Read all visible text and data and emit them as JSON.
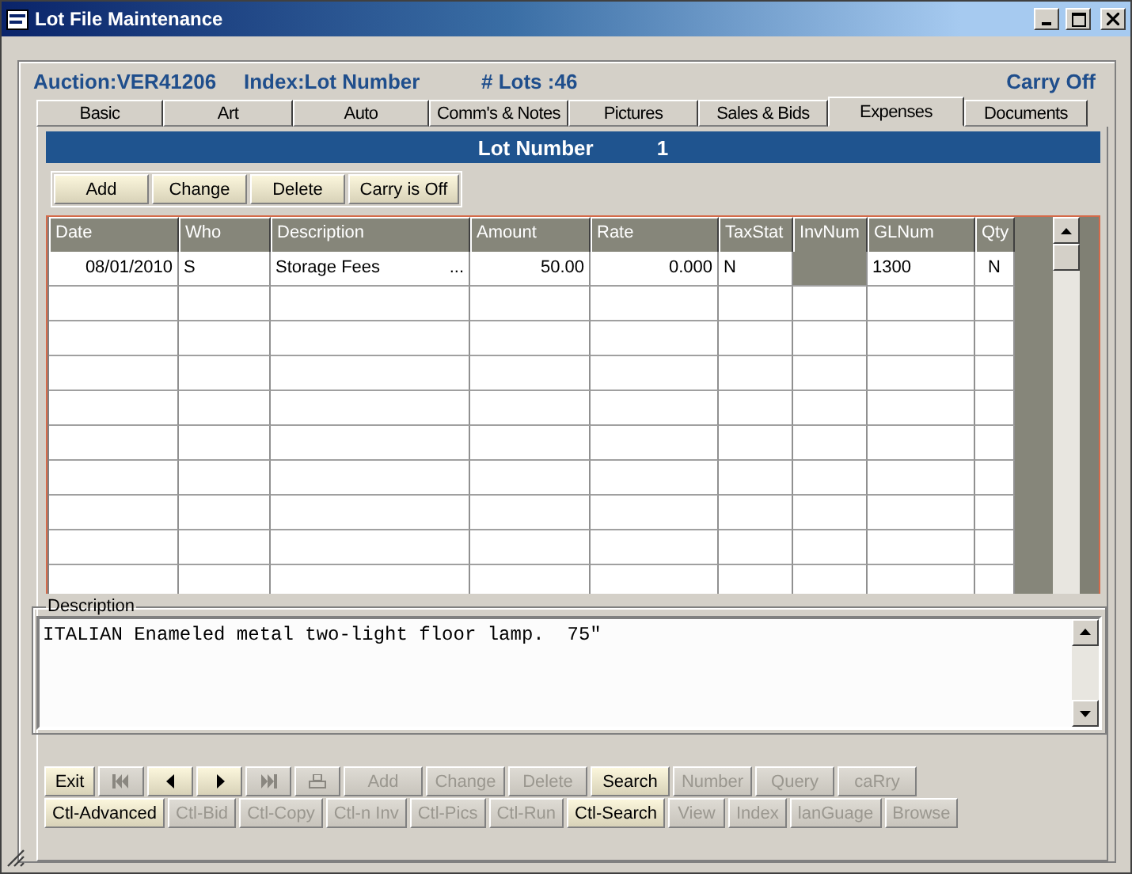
{
  "window": {
    "title": "Lot File Maintenance"
  },
  "header": {
    "auction": "Auction:VER41206",
    "index": "Index:Lot Number",
    "lots": "# Lots :46",
    "carry": "Carry Off"
  },
  "tabs": [
    {
      "label": "Basic",
      "selected": false
    },
    {
      "label": "Art",
      "selected": false
    },
    {
      "label": "Auto",
      "selected": false
    },
    {
      "label": "Comm's & Notes",
      "selected": false
    },
    {
      "label": "Pictures",
      "selected": false
    },
    {
      "label": "Sales & Bids",
      "selected": false
    },
    {
      "label": "Expenses",
      "selected": true
    },
    {
      "label": "Documents",
      "selected": false
    }
  ],
  "lot_bar": {
    "label": "Lot Number",
    "value": "1"
  },
  "toolbar": [
    "Add",
    "Change",
    "Delete",
    "Carry is Off"
  ],
  "table": {
    "columns": [
      "Date",
      "Who",
      "Description",
      "Amount",
      "Rate",
      "TaxStat",
      "InvNum",
      "GLNum",
      "Qty"
    ],
    "rows": [
      {
        "date": "08/01/2010",
        "who": "S",
        "description": "Storage Fees",
        "more": "...",
        "amount": "50.00",
        "rate": "0.000",
        "tax_stat": "N",
        "inv_num_locked": true,
        "gl_num": "1300",
        "qty": "N"
      }
    ]
  },
  "description": {
    "legend": "Description",
    "value": "ITALIAN Enameled metal two-light floor lamp.  75\""
  },
  "button_rows": [
    [
      {
        "kind": "text",
        "label": "Exit",
        "disabled": false
      },
      {
        "kind": "first",
        "disabled": true
      },
      {
        "kind": "prev",
        "disabled": false
      },
      {
        "kind": "next",
        "disabled": false
      },
      {
        "kind": "last",
        "disabled": true
      },
      {
        "kind": "print",
        "disabled": true
      },
      {
        "kind": "text",
        "label": "Add",
        "disabled": true
      },
      {
        "kind": "text",
        "label": "Change",
        "disabled": true
      },
      {
        "kind": "text",
        "label": "Delete",
        "disabled": true
      },
      {
        "kind": "text",
        "label": "Search",
        "disabled": false
      },
      {
        "kind": "text",
        "label": "Number",
        "disabled": true
      },
      {
        "kind": "text",
        "label": "Query",
        "disabled": true
      },
      {
        "kind": "text",
        "label": "caRry",
        "disabled": true
      }
    ],
    [
      {
        "kind": "text",
        "label": "Ctl-Advanced",
        "disabled": false
      },
      {
        "kind": "text",
        "label": "Ctl-Bid",
        "disabled": true
      },
      {
        "kind": "text",
        "label": "Ctl-Copy",
        "disabled": true
      },
      {
        "kind": "text",
        "label": "Ctl-n Inv",
        "disabled": true
      },
      {
        "kind": "text",
        "label": "Ctl-Pics",
        "disabled": true
      },
      {
        "kind": "text",
        "label": "Ctl-Run",
        "disabled": true
      },
      {
        "kind": "text",
        "label": "Ctl-Search",
        "disabled": false
      },
      {
        "kind": "text",
        "label": "View",
        "disabled": true
      },
      {
        "kind": "text",
        "label": "Index",
        "disabled": true
      },
      {
        "kind": "text",
        "label": "lanGuage",
        "disabled": true
      },
      {
        "kind": "text",
        "label": "Browse",
        "disabled": true
      }
    ]
  ]
}
